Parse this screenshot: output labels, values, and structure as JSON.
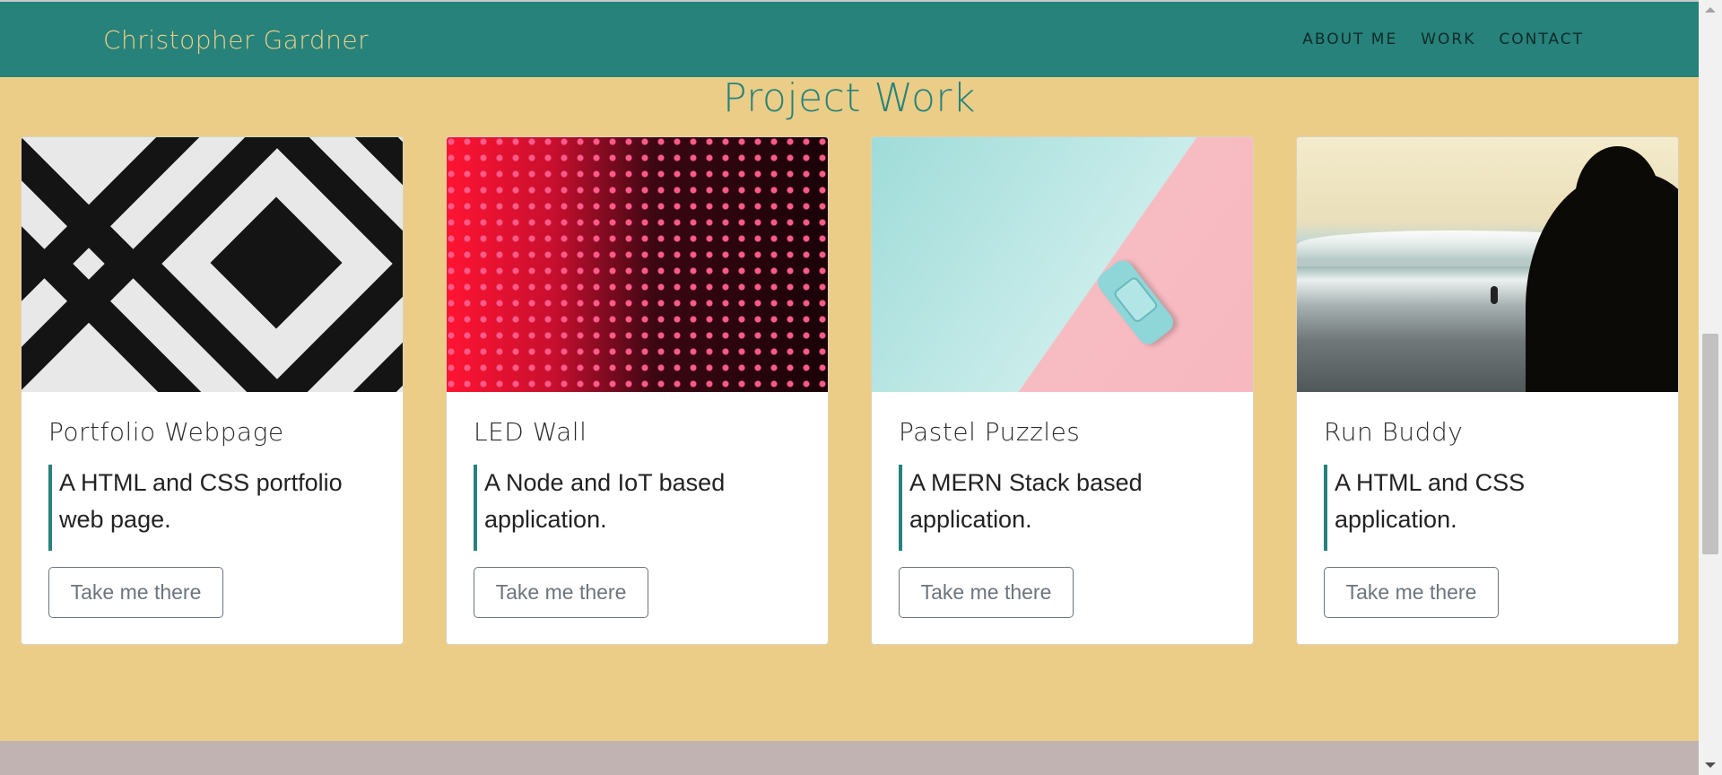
{
  "header": {
    "brand": "Christopher Gardner",
    "nav": [
      "ABOUT ME",
      "WORK",
      "CONTACT"
    ]
  },
  "section": {
    "title": "Project Work"
  },
  "cards": [
    {
      "title": "Portfolio Webpage",
      "text": "A HTML and CSS portfolio web page.",
      "button": "Take me there",
      "image": "black-white-diamond-pattern"
    },
    {
      "title": "LED Wall",
      "text": "A Node and IoT based application.",
      "button": "Take me there",
      "image": "red-led-wall"
    },
    {
      "title": "Pastel Puzzles",
      "text": "A MERN Stack based application.",
      "button": "Take me there",
      "image": "pastel-toy-car"
    },
    {
      "title": "Run Buddy",
      "text": "A HTML and CSS application.",
      "button": "Take me there",
      "image": "surf-beach-silhouette"
    }
  ],
  "colors": {
    "navbar": "#26827b",
    "brand": "#eecf87",
    "page_background": "#ebcd87",
    "accent": "#26827b",
    "footer_band": "#c1b3b2"
  }
}
